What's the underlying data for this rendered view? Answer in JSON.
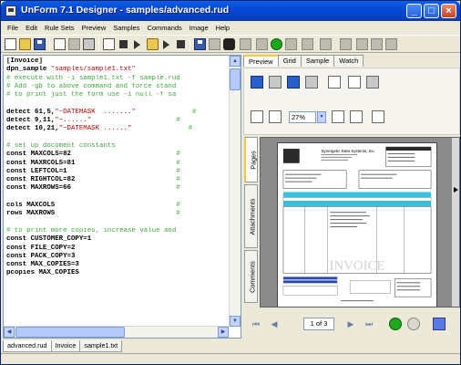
{
  "window": {
    "title": "UnForm 7.1 Designer - samples/advanced.rud"
  },
  "titlebar_buttons": {
    "minimize": "_",
    "maximize": "□",
    "close": "×"
  },
  "menu": [
    "File",
    "Edit",
    "Rule Sets",
    "Preview",
    "Samples",
    "Commands",
    "Image",
    "Help"
  ],
  "editor": {
    "lines": [
      {
        "parts": [
          {
            "t": "[Invoice]",
            "c": "kw"
          }
        ]
      },
      {
        "parts": [
          {
            "t": "d",
            "c": "kw"
          },
          {
            "t": "pn_sample ",
            "c": "kw"
          },
          {
            "t": "\"samples/sample1.txt\"",
            "c": "str"
          }
        ]
      },
      {
        "parts": [
          {
            "t": "# execute with -i sample1.txt -f sample.rud",
            "c": "cm"
          }
        ]
      },
      {
        "parts": [
          {
            "t": "# Add -gb to above command and force stand",
            "c": "cm"
          }
        ]
      },
      {
        "parts": [
          {
            "t": "# to print just the form use -i null -f sa",
            "c": "cm"
          }
        ]
      },
      {
        "parts": [
          {
            "t": "",
            "c": ""
          }
        ]
      },
      {
        "parts": [
          {
            "t": "detect ",
            "c": "kw"
          },
          {
            "t": "61,5,",
            "c": "kw"
          },
          {
            "t": "\"~DATEMASK  .......\"",
            "c": "str"
          },
          {
            "t": "              #",
            "c": "cm"
          }
        ]
      },
      {
        "parts": [
          {
            "t": "detect ",
            "c": "kw"
          },
          {
            "t": "9,11,",
            "c": "kw"
          },
          {
            "t": "\"~......\"",
            "c": "str"
          },
          {
            "t": "                     #",
            "c": "cm"
          }
        ]
      },
      {
        "parts": [
          {
            "t": "detect ",
            "c": "kw"
          },
          {
            "t": "10,21,",
            "c": "kw"
          },
          {
            "t": "\"~DATEMASK ......\"",
            "c": "str"
          },
          {
            "t": "              #",
            "c": "cm"
          }
        ]
      },
      {
        "parts": [
          {
            "t": "",
            "c": ""
          }
        ]
      },
      {
        "parts": [
          {
            "t": "# set up document constants",
            "c": "cm"
          }
        ]
      },
      {
        "parts": [
          {
            "t": "const ",
            "c": "kw"
          },
          {
            "t": "MAXCOLS=82",
            "c": "kw"
          },
          {
            "t": "                          #",
            "c": "cm"
          }
        ]
      },
      {
        "parts": [
          {
            "t": "const ",
            "c": "kw"
          },
          {
            "t": "MAXRCOLS=81",
            "c": "kw"
          },
          {
            "t": "                         #",
            "c": "cm"
          }
        ]
      },
      {
        "parts": [
          {
            "t": "const ",
            "c": "kw"
          },
          {
            "t": "LEFTCOL=1",
            "c": "kw"
          },
          {
            "t": "                           #",
            "c": "cm"
          }
        ]
      },
      {
        "parts": [
          {
            "t": "const ",
            "c": "kw"
          },
          {
            "t": "RIGHTCOL=82",
            "c": "kw"
          },
          {
            "t": "                         #",
            "c": "cm"
          }
        ]
      },
      {
        "parts": [
          {
            "t": "const ",
            "c": "kw"
          },
          {
            "t": "MAXROWS=66",
            "c": "kw"
          },
          {
            "t": "                          #",
            "c": "cm"
          }
        ]
      },
      {
        "parts": [
          {
            "t": "",
            "c": ""
          }
        ]
      },
      {
        "parts": [
          {
            "t": "cols ",
            "c": "kw"
          },
          {
            "t": "MAXCOLS",
            "c": "kw"
          },
          {
            "t": "                              #",
            "c": "cm"
          }
        ]
      },
      {
        "parts": [
          {
            "t": "rows ",
            "c": "kw"
          },
          {
            "t": "MAXROWS",
            "c": "kw"
          },
          {
            "t": "                              #",
            "c": "cm"
          }
        ]
      },
      {
        "parts": [
          {
            "t": "",
            "c": ""
          }
        ]
      },
      {
        "parts": [
          {
            "t": "# to print more copies, increase value and",
            "c": "cm"
          }
        ]
      },
      {
        "parts": [
          {
            "t": "const ",
            "c": "kw"
          },
          {
            "t": "CUSTOMER_COPY=1",
            "c": "kw"
          }
        ]
      },
      {
        "parts": [
          {
            "t": "const ",
            "c": "kw"
          },
          {
            "t": "FILE_COPY=2",
            "c": "kw"
          }
        ]
      },
      {
        "parts": [
          {
            "t": "const ",
            "c": "kw"
          },
          {
            "t": "PACK_COPY=3",
            "c": "kw"
          }
        ]
      },
      {
        "parts": [
          {
            "t": "const ",
            "c": "kw"
          },
          {
            "t": "MAX_COPIES=3",
            "c": "kw"
          }
        ]
      },
      {
        "parts": [
          {
            "t": "pcopies ",
            "c": "kw"
          },
          {
            "t": "MAX_COPIES",
            "c": "kw"
          }
        ]
      }
    ]
  },
  "right_tabs": [
    "Preview",
    "Grid",
    "Sample",
    "Watch"
  ],
  "zoom": "27%",
  "side_tabs": [
    "Pages",
    "Attachments",
    "Comments"
  ],
  "preview": {
    "company": "Synergetic Data Systems, Inc.",
    "watermark": "INVOICE"
  },
  "nav": {
    "page_label": "1 of 3"
  },
  "bottom_tabs": [
    "advanced.rud",
    "Invoice",
    "sample1.txt"
  ],
  "colors": {
    "title_bar": "#0548d0",
    "comment": "#40a840",
    "string": "#c00000"
  }
}
